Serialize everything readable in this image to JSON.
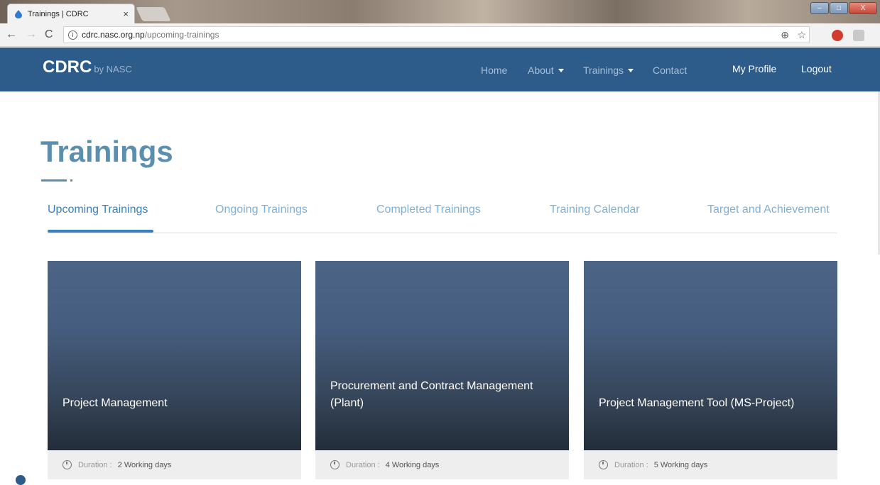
{
  "browser": {
    "tab_title": "Trainings | CDRC",
    "tab_close": "×",
    "url_host": "cdrc.nasc.org.np",
    "url_path": "/upcoming-trainings",
    "window_controls": [
      "–",
      "□",
      "X"
    ]
  },
  "header": {
    "brand": "CDRC",
    "brand_sub": "by NASC",
    "nav": {
      "home": "Home",
      "about": "About",
      "trainings": "Trainings",
      "contact": "Contact",
      "my_profile": "My Profile",
      "logout": "Logout"
    },
    "colors": {
      "bar": "#2d5c8a"
    }
  },
  "page": {
    "title": "Trainings",
    "tabs": [
      {
        "label": "Upcoming Trainings",
        "active": true
      },
      {
        "label": "Ongoing Trainings",
        "active": false
      },
      {
        "label": "Completed Trainings",
        "active": false
      },
      {
        "label": "Training Calendar",
        "active": false
      },
      {
        "label": "Target and Achievement",
        "active": false
      }
    ]
  },
  "cards": [
    {
      "title": "Project Management",
      "duration_label": "Duration :",
      "duration_value": "2 Working days"
    },
    {
      "title": "Procurement and Contract Management (Plant)",
      "duration_label": "Duration :",
      "duration_value": "4 Working days"
    },
    {
      "title": "Project Management Tool (MS-Project)",
      "duration_label": "Duration :",
      "duration_value": "5 Working days"
    }
  ]
}
